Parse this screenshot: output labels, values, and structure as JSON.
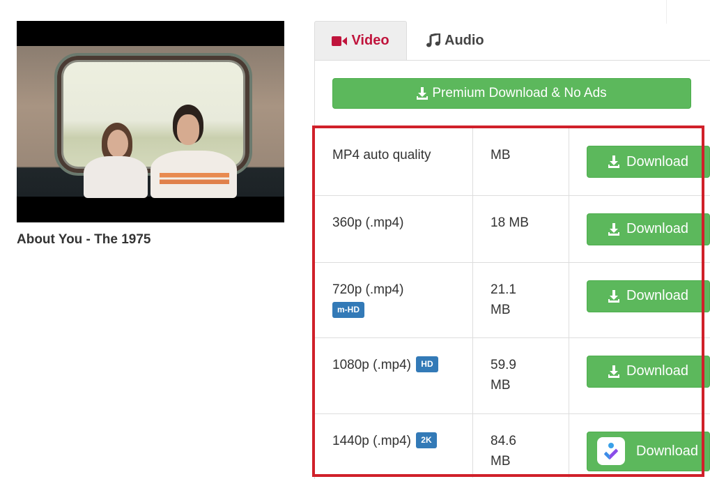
{
  "video": {
    "title": "About You - The 1975"
  },
  "tabs": [
    {
      "label": "Video",
      "icon": "video-camera-icon",
      "active": true
    },
    {
      "label": "Audio",
      "icon": "music-note-icon",
      "active": false
    }
  ],
  "premium_button": {
    "label": "Premium Download & No Ads",
    "icon": "download-icon"
  },
  "formats": [
    {
      "quality": "MP4 auto quality",
      "badge": null,
      "size": "MB",
      "button": "Download",
      "button_icon": "download-icon"
    },
    {
      "quality": "360p (.mp4)",
      "badge": null,
      "size": "18 MB",
      "button": "Download",
      "button_icon": "download-icon"
    },
    {
      "quality": "720p (.mp4)",
      "badge": "m-HD",
      "size": "21.1 MB",
      "button": "Download",
      "button_icon": "download-icon"
    },
    {
      "quality": "1080p (.mp4)",
      "badge": "HD",
      "size": "59.9 MB",
      "button": "Download",
      "button_icon": "download-icon"
    },
    {
      "quality": "1440p (.mp4)",
      "badge": "2K",
      "size": "84.6 MB",
      "button": "Download",
      "button_icon": "app-logo-icon"
    }
  ],
  "colors": {
    "active_tab": "#c0143c",
    "button_green": "#5cb85c",
    "badge_blue": "#337ab7",
    "highlight_red": "#d0202a"
  }
}
